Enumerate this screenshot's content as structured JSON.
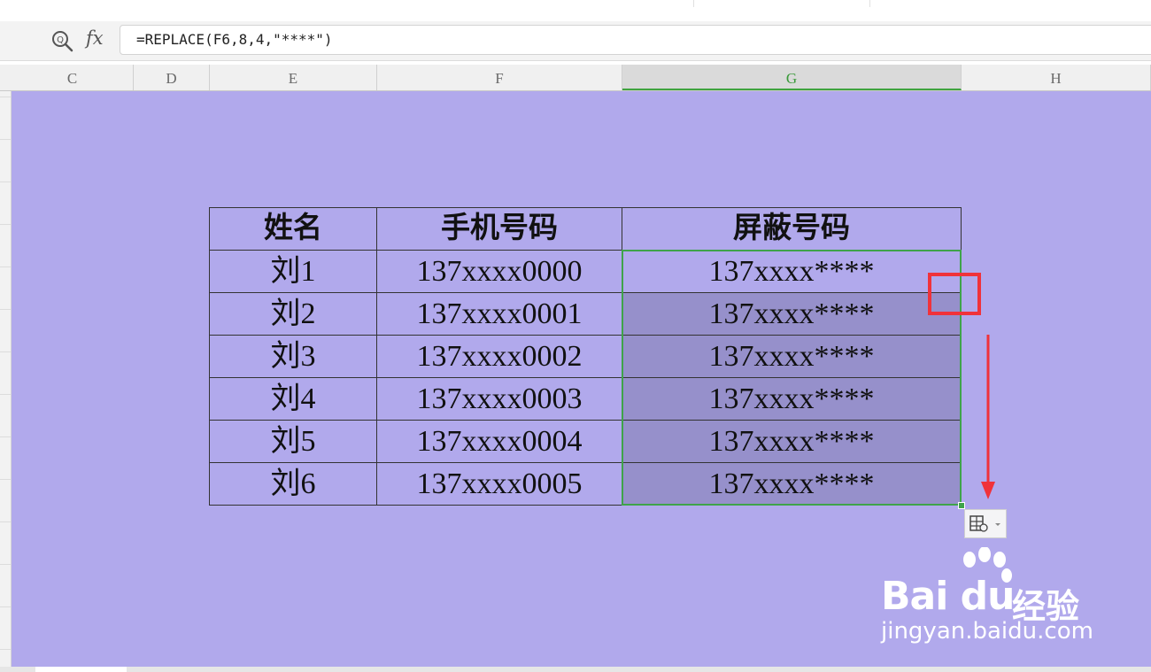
{
  "formula_bar": {
    "fx_label": "fx",
    "formula": "=REPLACE(F6,8,4,\"****\")"
  },
  "columns": [
    "C",
    "D",
    "E",
    "F",
    "G",
    "H"
  ],
  "selected_column": "G",
  "table": {
    "headers": [
      "姓名",
      "手机号码",
      "屏蔽号码"
    ],
    "rows": [
      [
        "刘1",
        "137xxxx0000",
        "137xxxx****"
      ],
      [
        "刘2",
        "137xxxx0001",
        "137xxxx****"
      ],
      [
        "刘3",
        "137xxxx0002",
        "137xxxx****"
      ],
      [
        "刘4",
        "137xxxx0003",
        "137xxxx****"
      ],
      [
        "刘5",
        "137xxxx0004",
        "137xxxx****"
      ],
      [
        "刘6",
        "137xxxx0005",
        "137xxxx****"
      ]
    ]
  },
  "watermark": {
    "brand": "Bai du",
    "suffix": "经验",
    "url": "jingyan.baidu.com"
  },
  "colors": {
    "sheet_background": "#b1a9ec",
    "selection_fill": "#9690cb",
    "selection_border": "#3fa34a",
    "annotation_red": "#f0323a"
  },
  "icons": {
    "formula_search": "zoom-icon",
    "autofill_options": "autofill-options-icon"
  }
}
